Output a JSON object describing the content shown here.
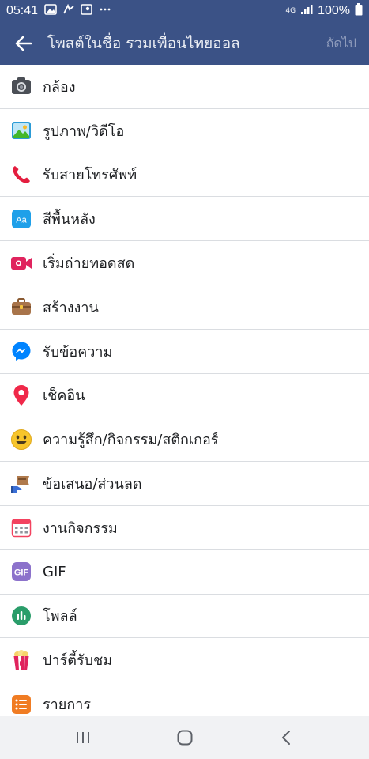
{
  "status_bar": {
    "time": "05:41",
    "network": "4G",
    "battery": "100%"
  },
  "header": {
    "title": "โพสต์ในชื่อ รวมเพื่อนไทยออล",
    "next_label": "ถัดไป"
  },
  "items": [
    {
      "label": "กล้อง",
      "icon": "camera-icon"
    },
    {
      "label": "รูปภาพ/วิดีโอ",
      "icon": "photo-icon"
    },
    {
      "label": "รับสายโทรศัพท์",
      "icon": "phone-icon"
    },
    {
      "label": "สีพื้นหลัง",
      "icon": "background-color-icon"
    },
    {
      "label": "เริ่มถ่ายทอดสด",
      "icon": "live-video-icon"
    },
    {
      "label": "สร้างงาน",
      "icon": "briefcase-icon"
    },
    {
      "label": "รับข้อความ",
      "icon": "messenger-icon"
    },
    {
      "label": "เช็คอิน",
      "icon": "location-pin-icon"
    },
    {
      "label": "ความรู้สึก/กิจกรรม/สติกเกอร์",
      "icon": "smiley-icon"
    },
    {
      "label": "ข้อเสนอ/ส่วนลด",
      "icon": "offer-tag-icon"
    },
    {
      "label": "งานกิจกรรม",
      "icon": "calendar-icon"
    },
    {
      "label": "GIF",
      "icon": "gif-icon"
    },
    {
      "label": "โพลล์",
      "icon": "poll-icon"
    },
    {
      "label": "ปาร์ตี้รับชม",
      "icon": "popcorn-icon"
    },
    {
      "label": "รายการ",
      "icon": "list-icon"
    }
  ],
  "colors": {
    "header_bg": "#3b5286",
    "divider": "#dadde1"
  }
}
